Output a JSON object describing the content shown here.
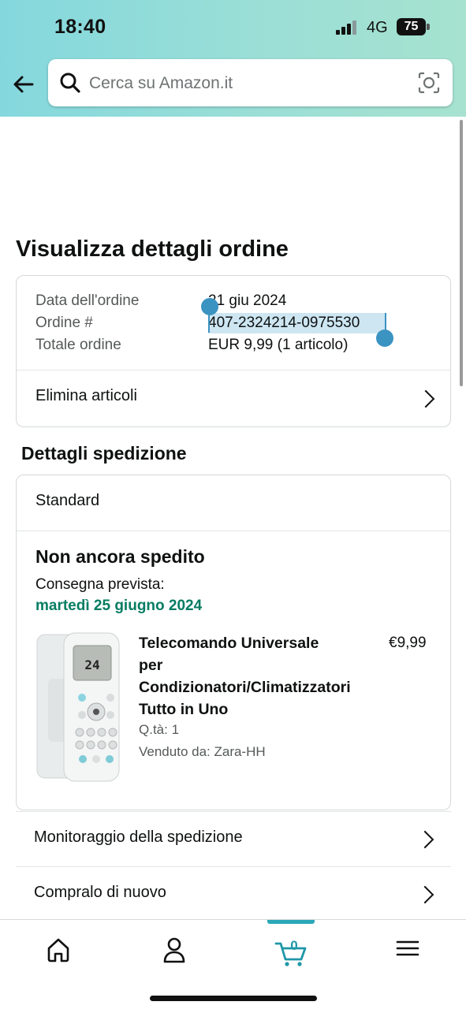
{
  "status_bar": {
    "time": "18:40",
    "network": "4G",
    "battery": "75"
  },
  "search": {
    "placeholder": "Cerca su Amazon.it"
  },
  "page_title": "Visualizza dettagli ordine",
  "order_summary": {
    "date_label": "Data dell'ordine",
    "date_value": "21 giu 2024",
    "order_label": "Ordine #",
    "order_value": "407-2324214-0975530",
    "total_label": "Totale ordine",
    "total_value": "EUR 9,99 (1 articolo)",
    "delete_items": "Elimina articoli"
  },
  "shipping": {
    "section_title": "Dettagli spedizione",
    "method": "Standard",
    "status": "Non ancora spedito",
    "expected_label": "Consegna prevista:",
    "expected_date": "martedì 25 giugno 2024",
    "product": {
      "name_lines": [
        "Telecomando Universale",
        "per",
        "Condizionatori/Climatizzatori",
        "Tutto in Uno"
      ],
      "price": "€9,99",
      "quantity": "Q.tà: 1",
      "seller": "Venduto da: Zara-HH",
      "display_value": "24"
    }
  },
  "actions": {
    "track": "Monitoraggio della spedizione",
    "buy_again": "Compralo di nuovo"
  },
  "bottom_nav": {
    "cart_count": "0",
    "items": [
      "home-icon",
      "account-icon",
      "cart-icon",
      "menu-icon"
    ],
    "active": "cart",
    "accent_color": "#2aa8b8"
  },
  "colors": {
    "delivery_green": "#067d62",
    "selection_blue": "#3b93c2"
  }
}
